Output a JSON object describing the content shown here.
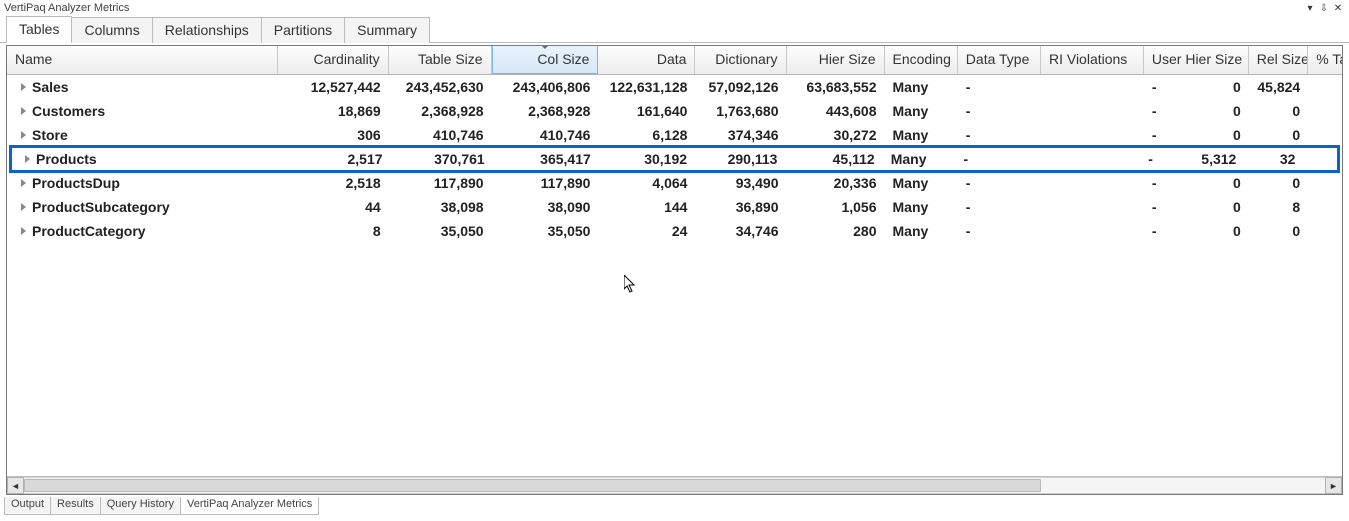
{
  "window": {
    "title": "VertiPaq Analyzer Metrics"
  },
  "tabs": [
    "Tables",
    "Columns",
    "Relationships",
    "Partitions",
    "Summary"
  ],
  "active_tab_index": 0,
  "columns": {
    "name": "Name",
    "cardinality": "Cardinality",
    "table_size": "Table Size",
    "col_size": "Col Size",
    "data": "Data",
    "dictionary": "Dictionary",
    "hier_size": "Hier Size",
    "encoding": "Encoding",
    "data_type": "Data Type",
    "ri_violations": "RI Violations",
    "user_hier_size": "User Hier Size",
    "rel_size": "Rel Size",
    "pct_table": "% Ta"
  },
  "sorted_column": "col_size",
  "rows": [
    {
      "name": "Sales",
      "cardinality": "12,527,442",
      "table_size": "243,452,630",
      "col_size": "243,406,806",
      "data": "122,631,128",
      "dictionary": "57,092,126",
      "hier_size": "63,683,552",
      "encoding": "Many",
      "data_type": "-",
      "ri_violations": "",
      "user_hier_size": "-",
      "user_hier_val": "0",
      "rel_size": "45,824",
      "selected": false
    },
    {
      "name": "Customers",
      "cardinality": "18,869",
      "table_size": "2,368,928",
      "col_size": "2,368,928",
      "data": "161,640",
      "dictionary": "1,763,680",
      "hier_size": "443,608",
      "encoding": "Many",
      "data_type": "-",
      "ri_violations": "",
      "user_hier_size": "-",
      "user_hier_val": "0",
      "rel_size": "0",
      "selected": false
    },
    {
      "name": "Store",
      "cardinality": "306",
      "table_size": "410,746",
      "col_size": "410,746",
      "data": "6,128",
      "dictionary": "374,346",
      "hier_size": "30,272",
      "encoding": "Many",
      "data_type": "-",
      "ri_violations": "",
      "user_hier_size": "-",
      "user_hier_val": "0",
      "rel_size": "0",
      "selected": false
    },
    {
      "name": "Products",
      "cardinality": "2,517",
      "table_size": "370,761",
      "col_size": "365,417",
      "data": "30,192",
      "dictionary": "290,113",
      "hier_size": "45,112",
      "encoding": "Many",
      "data_type": "-",
      "ri_violations": "",
      "user_hier_size": "-",
      "user_hier_val": "5,312",
      "rel_size": "32",
      "selected": true
    },
    {
      "name": "ProductsDup",
      "cardinality": "2,518",
      "table_size": "117,890",
      "col_size": "117,890",
      "data": "4,064",
      "dictionary": "93,490",
      "hier_size": "20,336",
      "encoding": "Many",
      "data_type": "-",
      "ri_violations": "",
      "user_hier_size": "-",
      "user_hier_val": "0",
      "rel_size": "0",
      "selected": false
    },
    {
      "name": "ProductSubcategory",
      "cardinality": "44",
      "table_size": "38,098",
      "col_size": "38,090",
      "data": "144",
      "dictionary": "36,890",
      "hier_size": "1,056",
      "encoding": "Many",
      "data_type": "-",
      "ri_violations": "",
      "user_hier_size": "-",
      "user_hier_val": "0",
      "rel_size": "8",
      "selected": false
    },
    {
      "name": "ProductCategory",
      "cardinality": "8",
      "table_size": "35,050",
      "col_size": "35,050",
      "data": "24",
      "dictionary": "34,746",
      "hier_size": "280",
      "encoding": "Many",
      "data_type": "-",
      "ri_violations": "",
      "user_hier_size": "-",
      "user_hier_val": "0",
      "rel_size": "0",
      "selected": false
    }
  ],
  "bottom_tabs": [
    "Output",
    "Results",
    "Query History",
    "VertiPaq Analyzer Metrics"
  ],
  "bottom_active_index": 3
}
